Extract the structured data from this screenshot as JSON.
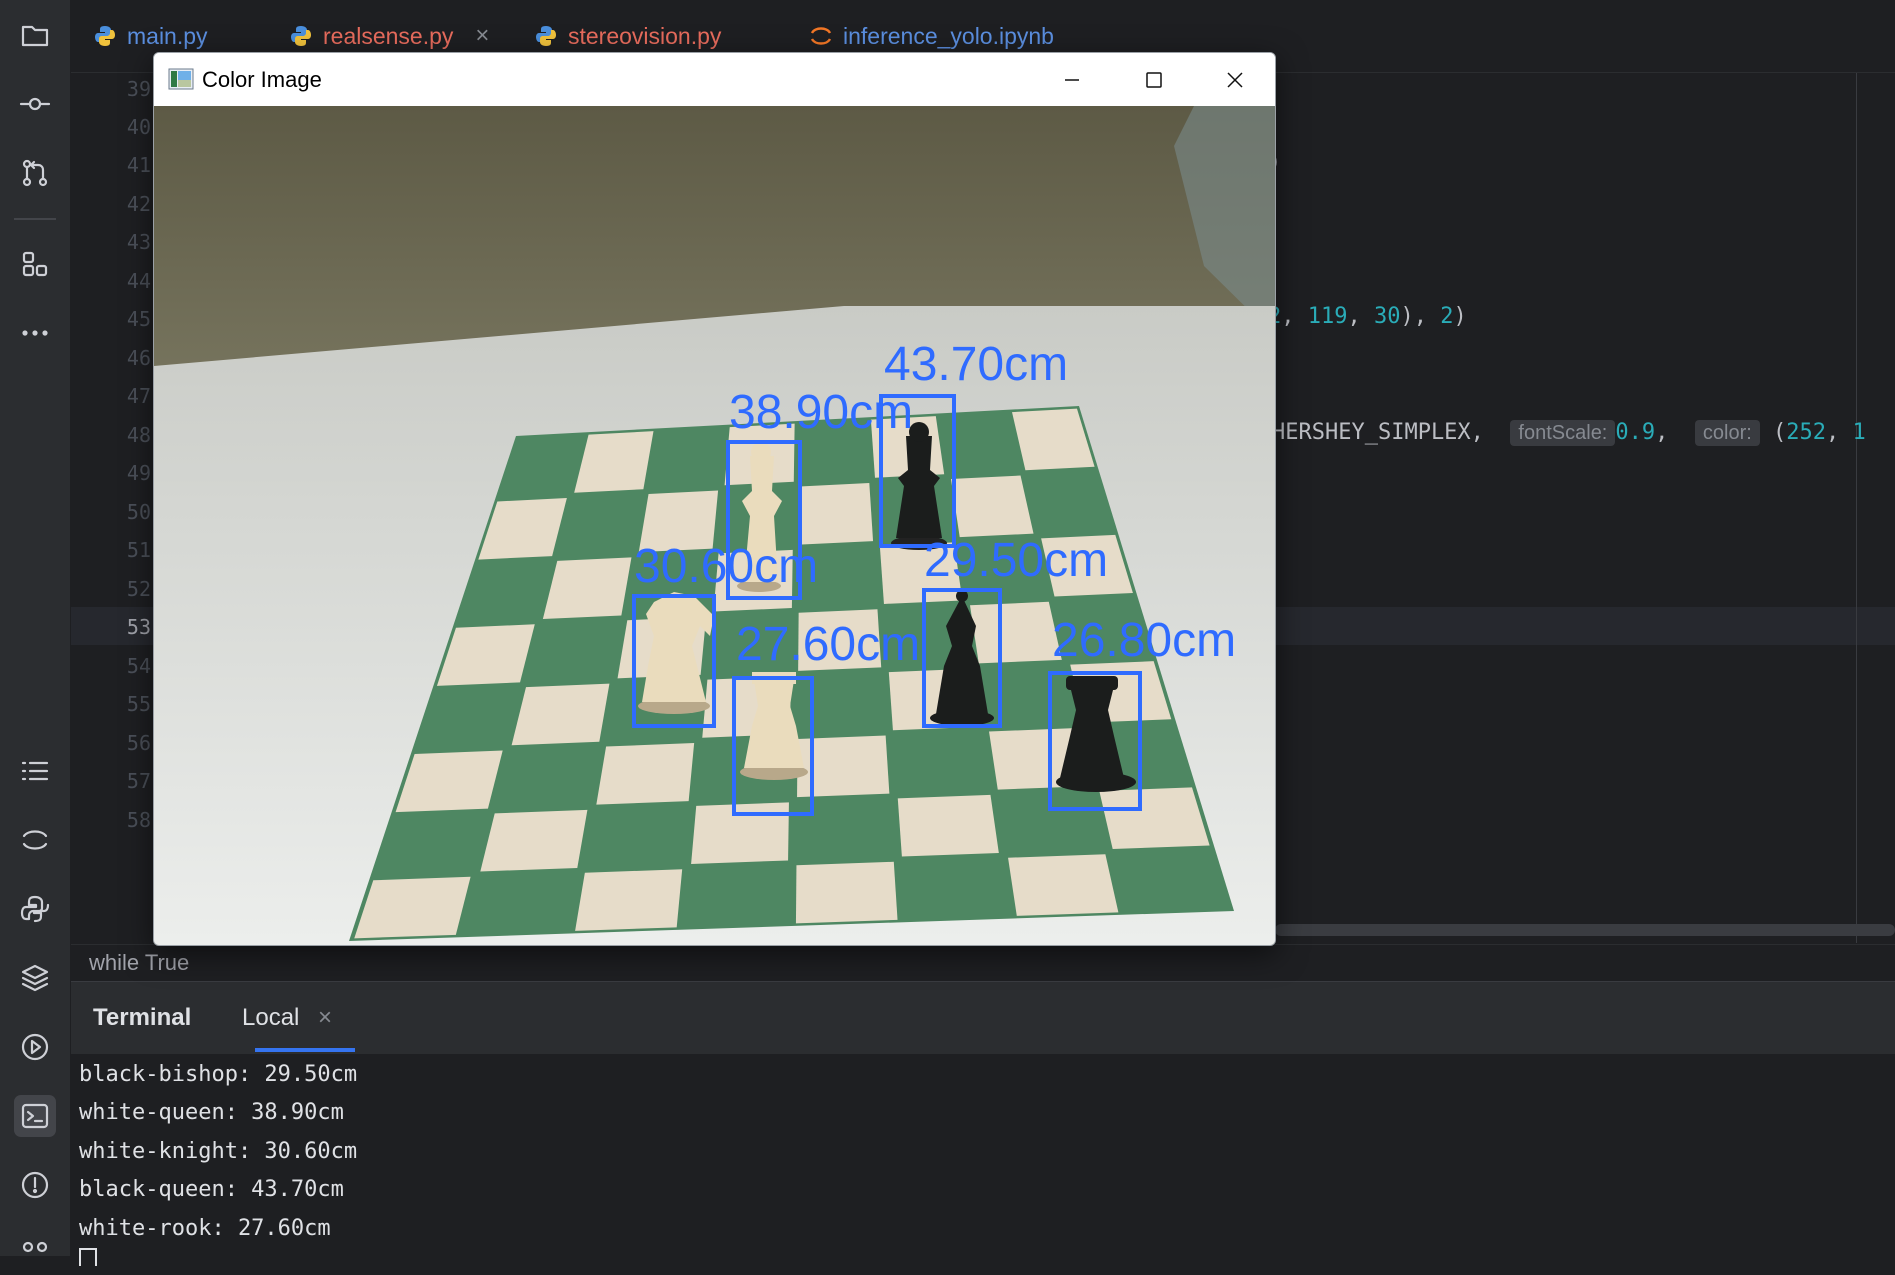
{
  "tabs": [
    {
      "label": "main.py",
      "color": "#5b8fe0",
      "icon": "python-icon",
      "closable": false
    },
    {
      "label": "realsense.py",
      "color": "#e86c5d",
      "icon": "python-icon",
      "closable": true
    },
    {
      "label": "stereovision.py",
      "color": "#e86c5d",
      "icon": "python-icon",
      "closable": false
    },
    {
      "label": "inference_yolo.ipynb",
      "color": "#5b8fe0",
      "icon": "jupyter-icon",
      "closable": false
    }
  ],
  "editor": {
    "line_numbers": [
      "39",
      "40",
      "41",
      "42",
      "43",
      "44",
      "45",
      "46",
      "47",
      "48",
      "49",
      "50",
      "51",
      "52",
      "53",
      "54",
      "55",
      "56",
      "57",
      "58"
    ],
    "current_line": "53",
    "line41_tail": ")",
    "line45": {
      "a": "2",
      "b": "119",
      "c": "30",
      "d": "2"
    },
    "line48": {
      "prefix": "HERSHEY_SIMPLEX,",
      "hint1": "fontScale:",
      "val1": "0.9",
      "hint2": "color:",
      "val2_prefix": "(",
      "val2": "252",
      "tail": "1"
    }
  },
  "breadcrumb": "while True",
  "terminal": {
    "tab_terminal": "Terminal",
    "tab_local": "Local",
    "close": "×",
    "lines": [
      "black-bishop: 29.50cm",
      "white-queen: 38.90cm",
      "white-knight: 30.60cm",
      "black-queen: 43.70cm",
      "white-rook: 27.60cm"
    ]
  },
  "popup": {
    "title": "Color Image",
    "detections": [
      {
        "label": "43.70cm",
        "piece": "black-queen"
      },
      {
        "label": "38.90cm",
        "piece": "white-queen"
      },
      {
        "label": "30.60cm",
        "piece": "white-knight"
      },
      {
        "label": "29.50cm",
        "piece": "black-bishop"
      },
      {
        "label": "27.60cm",
        "piece": "white-rook"
      },
      {
        "label": "26.80cm",
        "piece": "black-rook"
      }
    ],
    "box_color": "#2f6bff"
  },
  "colors": {
    "accent": "#3574f0",
    "board_green": "#4f8a63",
    "board_light": "#e6dcc9"
  }
}
